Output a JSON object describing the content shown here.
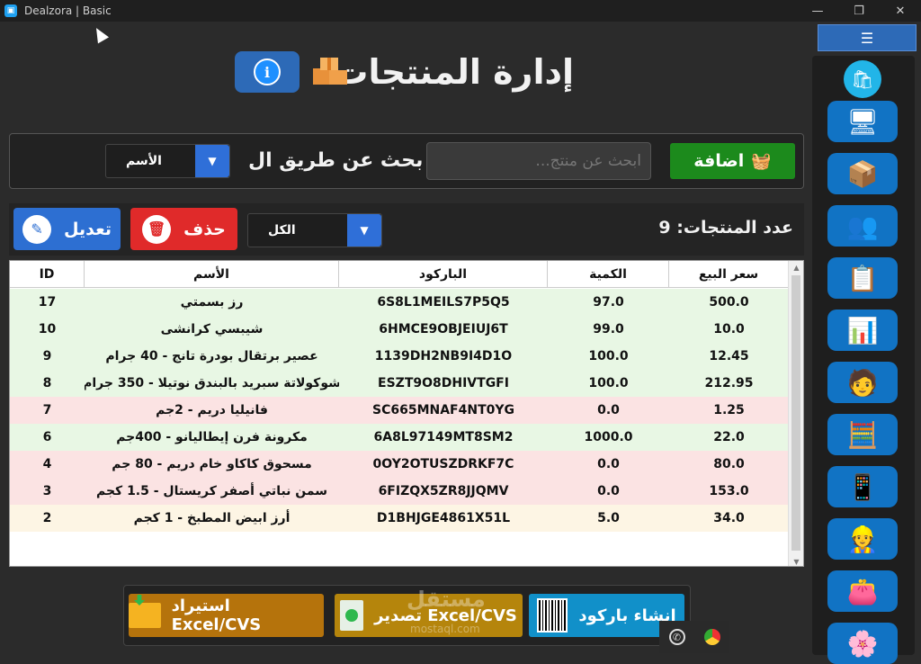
{
  "window": {
    "title": "Dealzora | Basic",
    "minimize": "—",
    "restore": "❐",
    "close": "✕"
  },
  "header": {
    "title": "إدارة المنتجات",
    "info_label": "i"
  },
  "search": {
    "add_label": "اضافة",
    "placeholder": "ابحث عن منتج...",
    "search_by_label": "بحث عن طريق ال",
    "search_by_value": "الأسم"
  },
  "toolbar": {
    "edit_label": "تعديل",
    "delete_label": "حذف",
    "filter_value": "الكل",
    "count_label": "عدد المنتجات: 9"
  },
  "table": {
    "columns": {
      "id": "ID",
      "name": "الأسم",
      "barcode": "الباركود",
      "qty": "الكمية",
      "price": "سعر البيع"
    },
    "rows": [
      {
        "id": "17",
        "name": "رز بسمتي",
        "barcode": "6S8L1MEILS7P5Q5",
        "qty": "97.0",
        "price": "500.0",
        "status": "ok"
      },
      {
        "id": "10",
        "name": "شيبسي كرانشى",
        "barcode": "6HMCE9OBJEIUJ6T",
        "qty": "99.0",
        "price": "10.0",
        "status": "ok"
      },
      {
        "id": "9",
        "name": "عصير برتقال بودرة تانج - 40 جرام",
        "barcode": "1139DH2NB9I4D1O",
        "qty": "100.0",
        "price": "12.45",
        "status": "ok"
      },
      {
        "id": "8",
        "name": "شوكولاتة سبريد بالبندق نوتيلا - 350 جرام",
        "barcode": "ESZT9O8DHIVTGFI",
        "qty": "100.0",
        "price": "212.95",
        "status": "ok"
      },
      {
        "id": "7",
        "name": "فانيليا دريم - 2جم",
        "barcode": "SC665MNAF4NT0YG",
        "qty": "0.0",
        "price": "1.25",
        "status": "out"
      },
      {
        "id": "6",
        "name": "مكرونة فرن إيطاليانو - 400جم",
        "barcode": "6A8L97149MT8SM2",
        "qty": "1000.0",
        "price": "22.0",
        "status": "ok"
      },
      {
        "id": "4",
        "name": "مسحوق كاكاو خام دريم - 80 جم",
        "barcode": "0OY2OTUSZDRKF7C",
        "qty": "0.0",
        "price": "80.0",
        "status": "out"
      },
      {
        "id": "3",
        "name": "سمن نباتي أصفر كريستال - 1.5 كجم",
        "barcode": "6FIZQX5ZR8JJQMV",
        "qty": "0.0",
        "price": "153.0",
        "status": "out"
      },
      {
        "id": "2",
        "name": "أرز ابيض المطبخ - 1 كجم",
        "barcode": "D1BHJGE4861X51L",
        "qty": "5.0",
        "price": "34.0",
        "status": "low"
      }
    ]
  },
  "bottom": {
    "import_label": "استيراد Excel/CVS",
    "export_label": "تصدير Excel/CVS",
    "barcode_label": "انشاء باركود",
    "watermark": "مستقل",
    "watermark_url": "mostaql.com"
  },
  "colors": {
    "row_ok": "#e8f7e4",
    "row_out": "#fbe3e3",
    "row_low": "#fdf5e4",
    "accent_blue": "#2d6fd2",
    "danger": "#e02a2a",
    "success": "#1c8a1c"
  },
  "sidebar": {
    "menu_icon": "☰",
    "items": [
      {
        "icon": "cash-register-icon",
        "glyph": "🖥"
      },
      {
        "icon": "products-box-icon",
        "glyph": "📦"
      },
      {
        "icon": "users-group-icon",
        "glyph": "👥"
      },
      {
        "icon": "inventory-clipboard-icon",
        "glyph": "📋"
      },
      {
        "icon": "reports-chart-icon",
        "glyph": "📊"
      },
      {
        "icon": "supplier-icon",
        "glyph": "🧑"
      },
      {
        "icon": "calculator-icon",
        "glyph": "🧮"
      },
      {
        "icon": "phone-note-icon",
        "glyph": "📱"
      },
      {
        "icon": "employee-icon",
        "glyph": "👷"
      },
      {
        "icon": "wallet-icon",
        "glyph": "👛"
      },
      {
        "icon": "settings-flower-icon",
        "glyph": "🌸"
      }
    ]
  }
}
